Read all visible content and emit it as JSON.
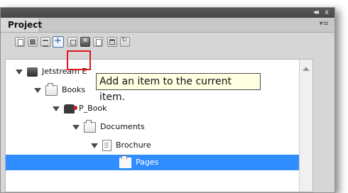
{
  "panel": {
    "title_controls": {
      "collapse": "◂◂",
      "close": "x"
    },
    "tab_label": "Project",
    "menu_icon": "panel-menu-icon"
  },
  "toolbar": {
    "buttons": [
      {
        "name": "open-item-button",
        "icon": "document-icon"
      },
      {
        "name": "save-button",
        "icon": "disk-icon"
      },
      {
        "name": "properties-button",
        "icon": "properties-icon"
      },
      {
        "name": "add-item-button",
        "icon": "plus-icon"
      },
      {
        "name": "copy-button",
        "icon": "copy-icon"
      },
      {
        "name": "delete-button",
        "icon": "delete-icon"
      },
      {
        "name": "new-page-button",
        "icon": "page-icon"
      },
      {
        "name": "view-button",
        "icon": "window-icon"
      },
      {
        "name": "refresh-button",
        "icon": "refresh-icon"
      }
    ]
  },
  "tooltip": {
    "text": "Add an item to the current item."
  },
  "tree": {
    "items": [
      {
        "label": "Jetstream E",
        "icon": "database-icon",
        "level": 0
      },
      {
        "label": "Books",
        "icon": "folder-icon",
        "level": 1
      },
      {
        "label": "P_Book",
        "icon": "book-icon",
        "level": 2
      },
      {
        "label": "Documents",
        "icon": "folder-icon",
        "level": 3
      },
      {
        "label": "Brochure",
        "icon": "page-icon",
        "level": 4
      },
      {
        "label": "Pages",
        "icon": "folder-icon",
        "level": 5,
        "selected": true
      }
    ]
  },
  "colors": {
    "selection": "#2f8dff",
    "highlight_frame": "#e0161e",
    "tooltip_bg": "#ffffe1"
  }
}
